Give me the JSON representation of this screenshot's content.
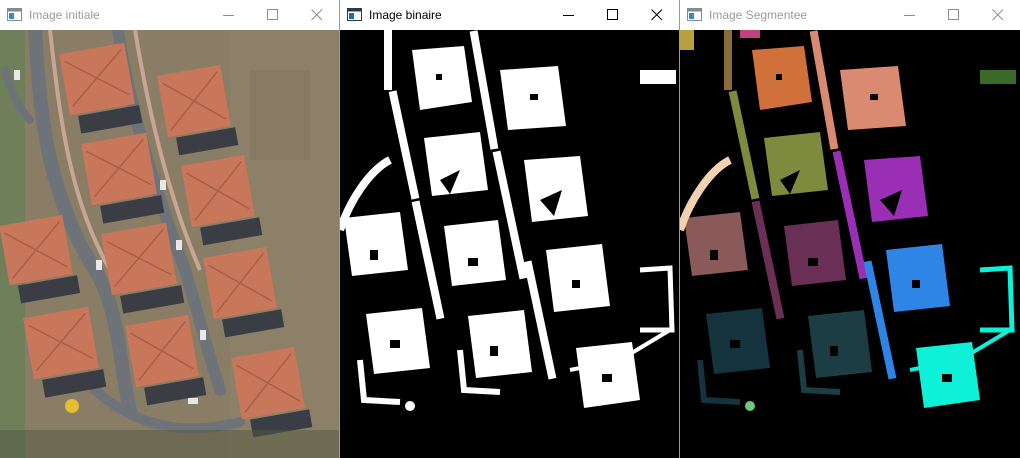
{
  "windows": [
    {
      "title": "Image initiale",
      "state": "inactive",
      "image": "aerial-photo",
      "controls": [
        "minimize-icon",
        "maximize-icon",
        "close-icon"
      ]
    },
    {
      "title": "Image binaire",
      "state": "active",
      "image": "binary-mask",
      "controls": [
        "minimize-icon",
        "maximize-icon",
        "close-icon"
      ]
    },
    {
      "title": "Image Segmentee",
      "state": "inactive",
      "image": "segmentation-map",
      "controls": [
        "minimize-icon",
        "maximize-icon",
        "close-icon"
      ]
    }
  ],
  "colors": {
    "roof": "#c8775a",
    "ground": "#8a7d66",
    "road": "#6d7378",
    "binary_fg": "#ffffff",
    "binary_bg": "#000000",
    "segments": [
      "#d0703a",
      "#d98a70",
      "#7e8a3d",
      "#9a2fb5",
      "#8a5a5a",
      "#6a2f55",
      "#2f85e6",
      "#14333c",
      "#1d3d45",
      "#0ef0d8"
    ]
  }
}
